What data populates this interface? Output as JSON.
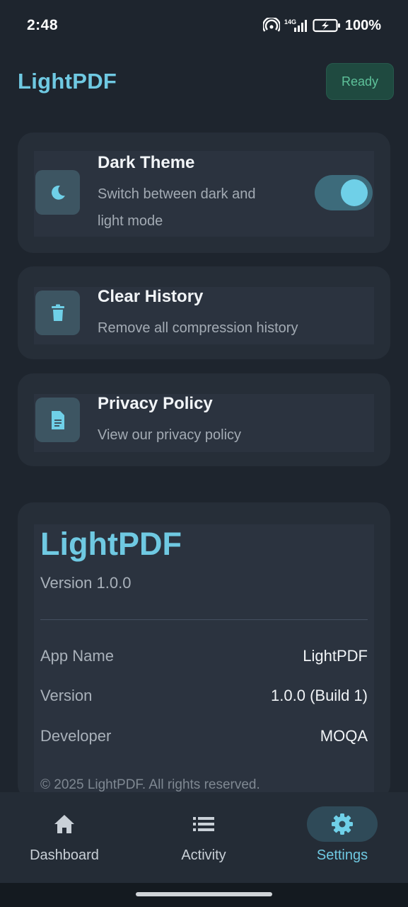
{
  "status_bar": {
    "time": "2:48",
    "network": "4G",
    "battery": "100%"
  },
  "app_bar": {
    "title": "LightPDF",
    "status_badge": "Ready"
  },
  "settings": [
    {
      "icon": "moon-icon",
      "title": "Dark Theme",
      "subtitle_line1": "Switch between dark and",
      "subtitle_line2": "light mode",
      "toggle_on": true
    },
    {
      "icon": "trash-icon",
      "title": "Clear History",
      "subtitle_line1": "Remove all compression history"
    },
    {
      "icon": "document-icon",
      "title": "Privacy Policy",
      "subtitle_line1": "View our privacy policy"
    }
  ],
  "about": {
    "title": "LightPDF",
    "version": "Version 1.0.0",
    "rows": [
      {
        "label": "App Name",
        "value": "LightPDF"
      },
      {
        "label": "Version",
        "value": "1.0.0 (Build 1)"
      },
      {
        "label": "Developer",
        "value": "MOQA"
      }
    ],
    "copyright": "© 2025 LightPDF. All rights reserved."
  },
  "bottom_nav": [
    {
      "icon": "home-icon",
      "label": "Dashboard",
      "active": false
    },
    {
      "icon": "list-icon",
      "label": "Activity",
      "active": false
    },
    {
      "icon": "gear-icon",
      "label": "Settings",
      "active": true
    }
  ],
  "colors": {
    "background": "#1e252e",
    "accent": "#6fc9e2",
    "card": "#262e38",
    "badge_bg": "#1f4a40",
    "badge_text": "#5ec29a"
  }
}
